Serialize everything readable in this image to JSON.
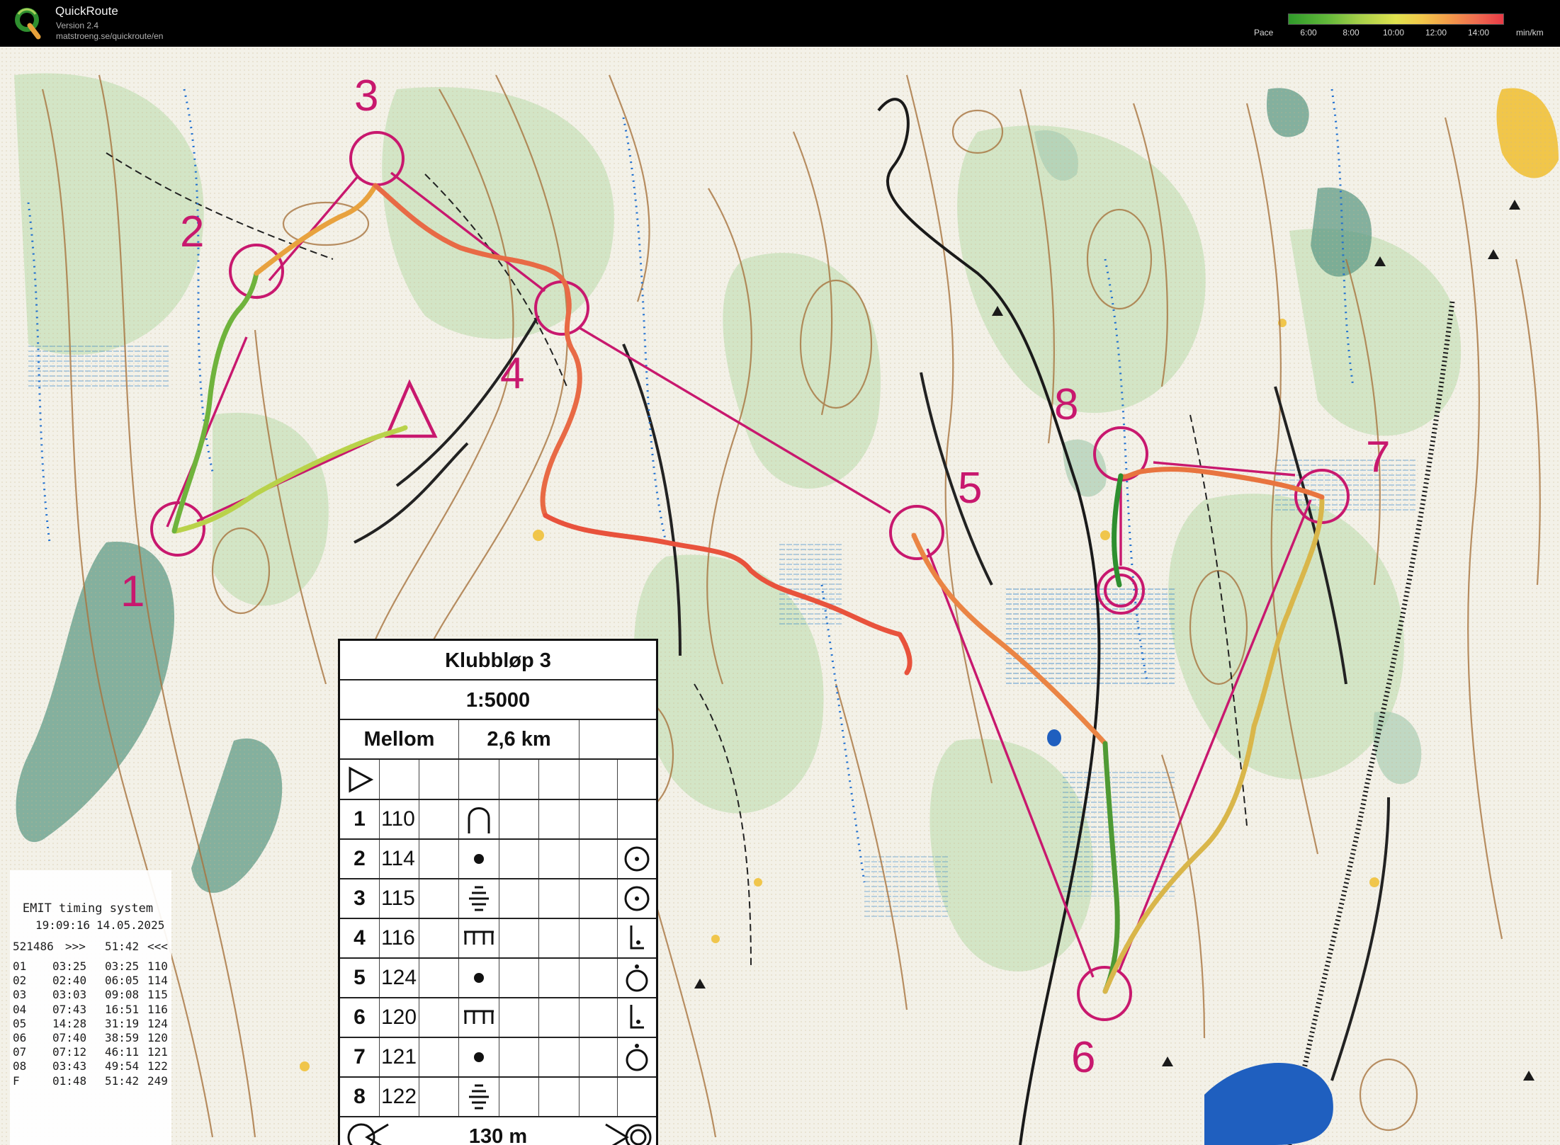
{
  "app": {
    "title": "QuickRoute",
    "version": "Version 2.4",
    "url": "matstroeng.se/quickroute/en"
  },
  "pace_legend": {
    "label": "Pace",
    "ticks": [
      "6:00",
      "8:00",
      "10:00",
      "12:00",
      "14:00"
    ],
    "unit": "min/km"
  },
  "course": {
    "title": "Klubbløp 3",
    "scale": "1:5000",
    "class": "Mellom",
    "length": "2,6 km",
    "controls": [
      {
        "num": "1",
        "code": "110"
      },
      {
        "num": "2",
        "code": "114"
      },
      {
        "num": "3",
        "code": "115"
      },
      {
        "num": "4",
        "code": "116"
      },
      {
        "num": "5",
        "code": "124"
      },
      {
        "num": "6",
        "code": "120"
      },
      {
        "num": "7",
        "code": "121"
      },
      {
        "num": "8",
        "code": "122"
      }
    ],
    "finish_distance": "130 m",
    "map_numbers": [
      "1",
      "2",
      "3",
      "4",
      "5",
      "6",
      "7",
      "8"
    ]
  },
  "emit_ticket": {
    "title": "EMIT timing system",
    "time": "19:09:16",
    "date": "14.05.2025",
    "header": {
      "id": "521486",
      "start": ">>>",
      "total": "51:42",
      "end": "<<<"
    },
    "splits": [
      {
        "leg": "01",
        "split": "03:25",
        "cum": "03:25",
        "code": "110"
      },
      {
        "leg": "02",
        "split": "02:40",
        "cum": "06:05",
        "code": "114"
      },
      {
        "leg": "03",
        "split": "03:03",
        "cum": "09:08",
        "code": "115"
      },
      {
        "leg": "04",
        "split": "07:43",
        "cum": "16:51",
        "code": "116"
      },
      {
        "leg": "05",
        "split": "14:28",
        "cum": "31:19",
        "code": "124"
      },
      {
        "leg": "06",
        "split": "07:40",
        "cum": "38:59",
        "code": "120"
      },
      {
        "leg": "07",
        "split": "07:12",
        "cum": "46:11",
        "code": "121"
      },
      {
        "leg": "08",
        "split": "03:43",
        "cum": "49:54",
        "code": "122"
      },
      {
        "leg": "F",
        "split": "01:48",
        "cum": "51:42",
        "code": "249"
      }
    ]
  },
  "colors": {
    "course": "#c8186e",
    "route_fast": "#2e9a30",
    "route_slow": "#e8523c",
    "forest_green": "#bcd9a8",
    "dark_green": "#5f9a86",
    "contour": "#a7743f",
    "water": "#1f5fbf",
    "marsh_blue": "#2a7ec8",
    "open_yellow": "#f1c64a"
  }
}
